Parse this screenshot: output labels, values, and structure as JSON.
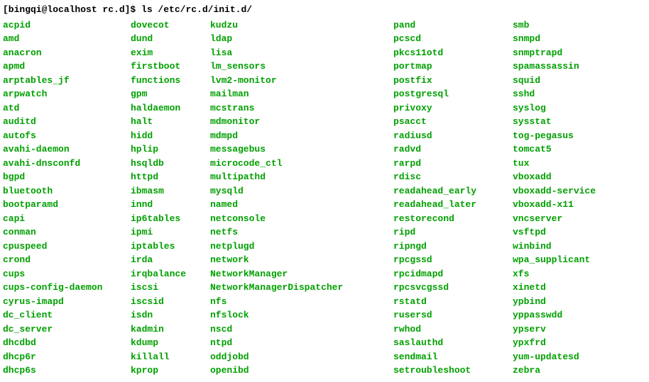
{
  "prompt": "[bingqi@localhost rc.d]$ ls /etc/rc.d/init.d/",
  "columns": [
    [
      "acpid",
      "amd",
      "anacron",
      "apmd",
      "arptables_jf",
      "arpwatch",
      "atd",
      "auditd",
      "autofs",
      "avahi-daemon",
      "avahi-dnsconfd",
      "bgpd",
      "bluetooth",
      "bootparamd",
      "capi",
      "conman",
      "cpuspeed",
      "crond",
      "cups",
      "cups-config-daemon",
      "cyrus-imapd",
      "dc_client",
      "dc_server",
      "dhcdbd",
      "dhcp6r",
      "dhcp6s"
    ],
    [
      "dovecot",
      "dund",
      "exim",
      "firstboot",
      "functions",
      "gpm",
      "haldaemon",
      "halt",
      "hidd",
      "hplip",
      "hsqldb",
      "httpd",
      "ibmasm",
      "innd",
      "ip6tables",
      "ipmi",
      "iptables",
      "irda",
      "irqbalance",
      "iscsi",
      "iscsid",
      "isdn",
      "kadmin",
      "kdump",
      "killall",
      "kprop"
    ],
    [
      "kudzu",
      "ldap",
      "lisa",
      "lm_sensors",
      "lvm2-monitor",
      "mailman",
      "mcstrans",
      "mdmonitor",
      "mdmpd",
      "messagebus",
      "microcode_ctl",
      "multipathd",
      "mysqld",
      "named",
      "netconsole",
      "netfs",
      "netplugd",
      "network",
      "NetworkManager",
      "NetworkManagerDispatcher",
      "nfs",
      "nfslock",
      "nscd",
      "ntpd",
      "oddjobd",
      "openibd"
    ],
    [
      "pand",
      "pcscd",
      "pkcs11otd",
      "portmap",
      "postfix",
      "postgresql",
      "privoxy",
      "psacct",
      "radiusd",
      "radvd",
      "rarpd",
      "rdisc",
      "readahead_early",
      "readahead_later",
      "restorecond",
      "ripd",
      "ripngd",
      "rpcgssd",
      "rpcidmapd",
      "rpcsvcgssd",
      "rstatd",
      "rusersd",
      "rwhod",
      "saslauthd",
      "sendmail",
      "setroubleshoot"
    ],
    [
      "smb",
      "snmpd",
      "snmptrapd",
      "spamassassin",
      "squid",
      "sshd",
      "syslog",
      "sysstat",
      "tog-pegasus",
      "tomcat5",
      "tux",
      "vboxadd",
      "vboxadd-service",
      "vboxadd-x11",
      "vncserver",
      "vsftpd",
      "winbind",
      "wpa_supplicant",
      "xfs",
      "xinetd",
      "ypbind",
      "yppasswdd",
      "ypserv",
      "ypxfrd",
      "yum-updatesd",
      "zebra"
    ]
  ]
}
